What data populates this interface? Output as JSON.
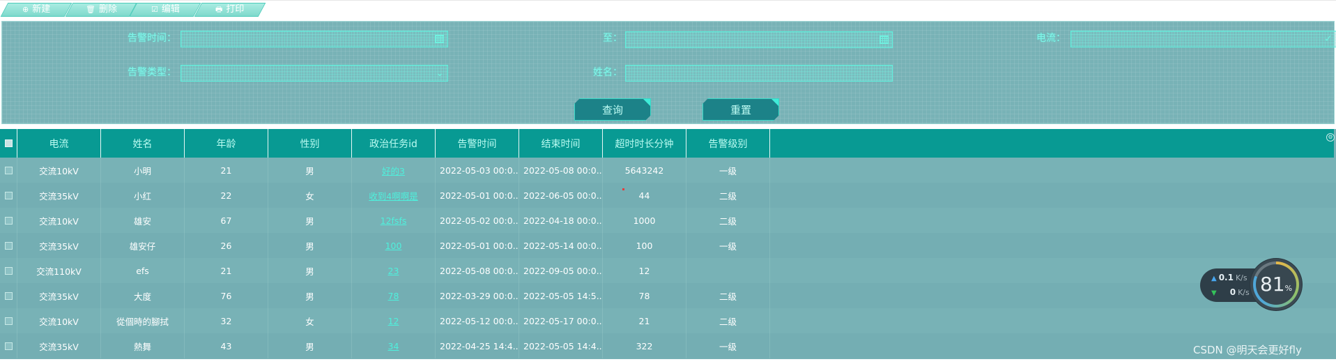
{
  "toolbar": {
    "new_label": "新建",
    "delete_label": "删除",
    "edit_label": "编辑",
    "print_label": "打印"
  },
  "search": {
    "alarm_time_label": "告警时间：",
    "to_label": "至：",
    "current_label": "电流：",
    "alarm_type_label": "告警类型：",
    "name_label": "姓名："
  },
  "buttons": {
    "query_label": "查询",
    "reset_label": "重置"
  },
  "table": {
    "columns": [
      "电流",
      "姓名",
      "年龄",
      "性别",
      "政治任务id",
      "告警时间",
      "结束时间",
      "超时时长分钟",
      "告警级别"
    ],
    "rows": [
      [
        "交流10kV",
        "小明",
        "21",
        "男",
        "好的3",
        "2022-05-03 00:0...",
        "2022-05-08 00:0...",
        "5643242",
        "一级"
      ],
      [
        "交流35kV",
        "小红",
        "22",
        "女",
        "收到4啊啊是",
        "2022-05-01 00:0...",
        "2022-06-05 00:0...",
        "44",
        "二级"
      ],
      [
        "交流10kV",
        "雄安",
        "67",
        "男",
        "12fsfs",
        "2022-05-02 00:0...",
        "2022-04-18 00:0...",
        "1000",
        "二级"
      ],
      [
        "交流35kV",
        "雄安仔",
        "26",
        "男",
        "100",
        "2022-05-01 00:0...",
        "2022-05-14 00:0...",
        "100",
        "一级"
      ],
      [
        "交流110kV",
        "efs",
        "21",
        "男",
        "23",
        "2022-05-08 00:0...",
        "2022-09-05 00:0...",
        "12",
        ""
      ],
      [
        "交流35kV",
        "大度",
        "76",
        "男",
        "78",
        "2022-03-29 00:0...",
        "2022-05-05 14:5...",
        "78",
        "二级"
      ],
      [
        "交流10kV",
        "從個時的腳拭",
        "32",
        "女",
        "12",
        "2022-05-12 00:0...",
        "2022-05-17 00:0...",
        "21",
        "二级"
      ],
      [
        "交流35kV",
        "熱舞",
        "43",
        "男",
        "34",
        "2022-04-25 14:4...",
        "2022-05-05 14:4...",
        "322",
        "一级"
      ]
    ]
  },
  "netspeed": {
    "up_value": "0.1",
    "up_unit": "K/s",
    "down_value": "0",
    "down_unit": "K/s"
  },
  "gauge": {
    "value": "81",
    "unit": "%"
  },
  "watermark": "CSDN @明天会更好fly",
  "colors": {
    "panel_bg": "#78b2b6",
    "header_bg": "#089a93",
    "accent": "#4ff0dc",
    "button_bg": "#1c8288"
  }
}
